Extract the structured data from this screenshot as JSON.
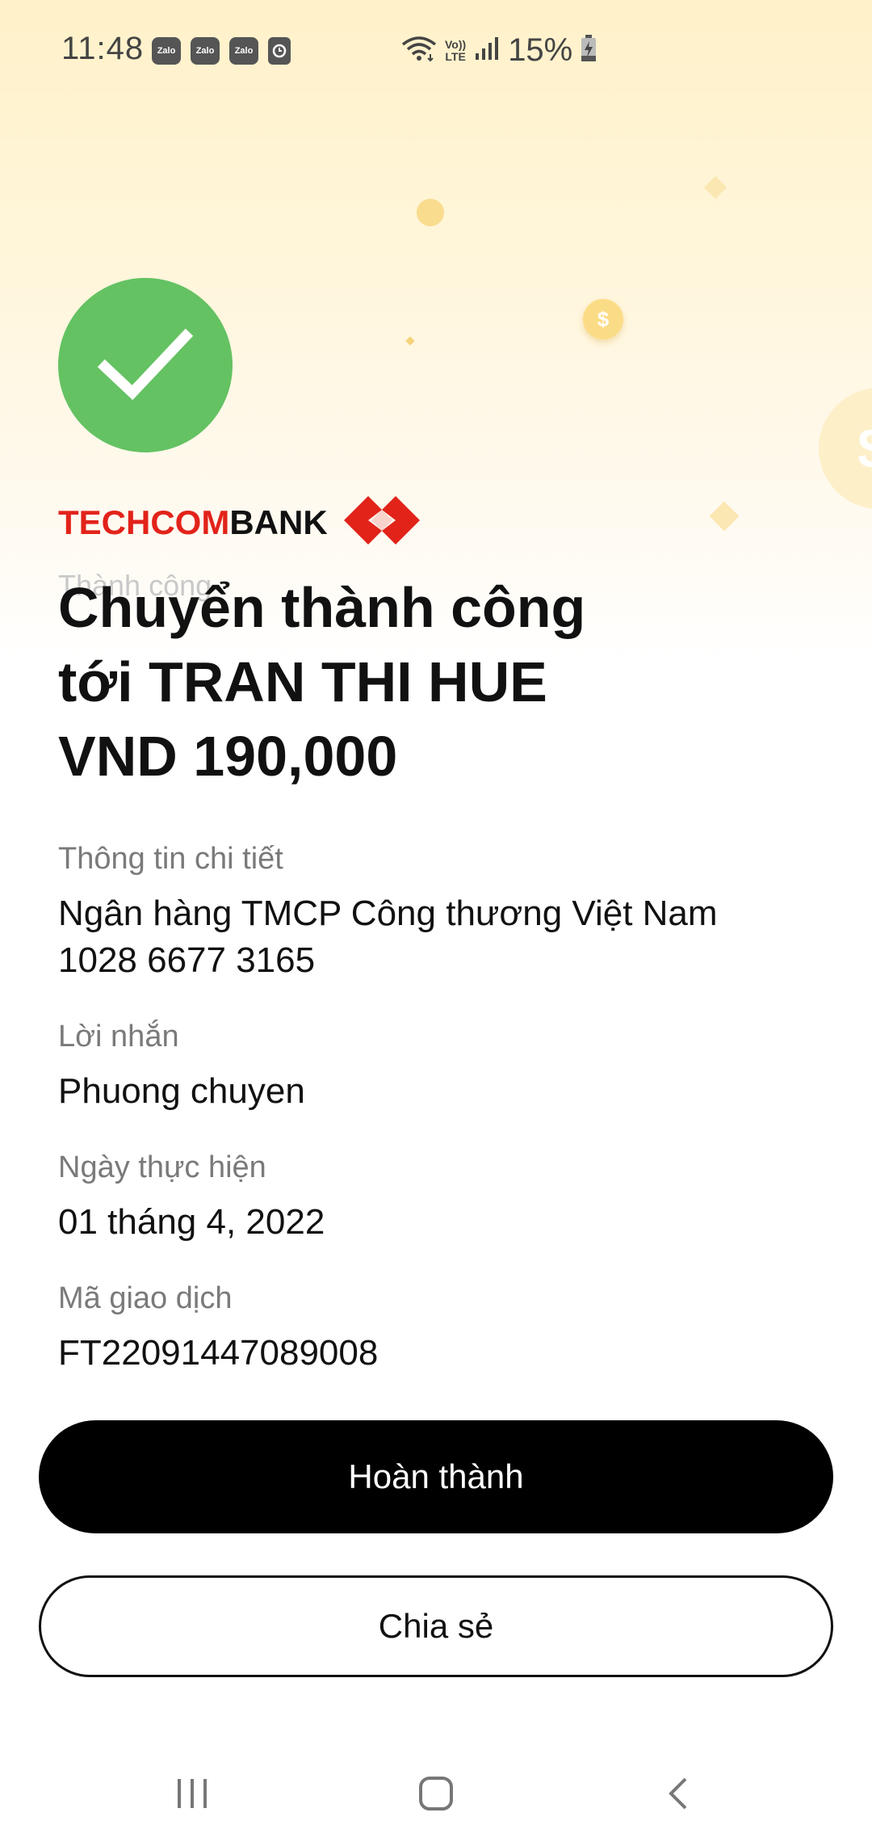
{
  "status_bar": {
    "time": "11:48",
    "notifications": [
      "Zalo",
      "Zalo",
      "Zalo"
    ],
    "battery": "15%",
    "network_label_top": "Vo))",
    "network_label_bottom": "LTE"
  },
  "bank": {
    "name_part1": "TECHCOM",
    "name_part2": "BANK",
    "brand_color": "#e2231a"
  },
  "success": {
    "ghost_label": "Thành công",
    "line1": "Chuyển thành công",
    "line2": "tới TRAN THI HUE",
    "line3": "VND 190,000",
    "check_color": "#64c262"
  },
  "details": {
    "info_label": "Thông tin chi tiết",
    "bank_name": "Ngân hàng TMCP Công thương Việt Nam",
    "account_number": "1028 6677 3165",
    "message_label": "Lời nhắn",
    "message_value": "Phuong chuyen",
    "date_label": "Ngày thực hiện",
    "date_value": "01 tháng 4, 2022",
    "txn_label": "Mã giao dịch",
    "txn_value": "FT22091447089008"
  },
  "actions": {
    "done_label": "Hoàn thành",
    "share_label": "Chia sẻ"
  },
  "nav": {
    "recents": "recents-icon",
    "home": "home-icon",
    "back": "back-icon"
  }
}
